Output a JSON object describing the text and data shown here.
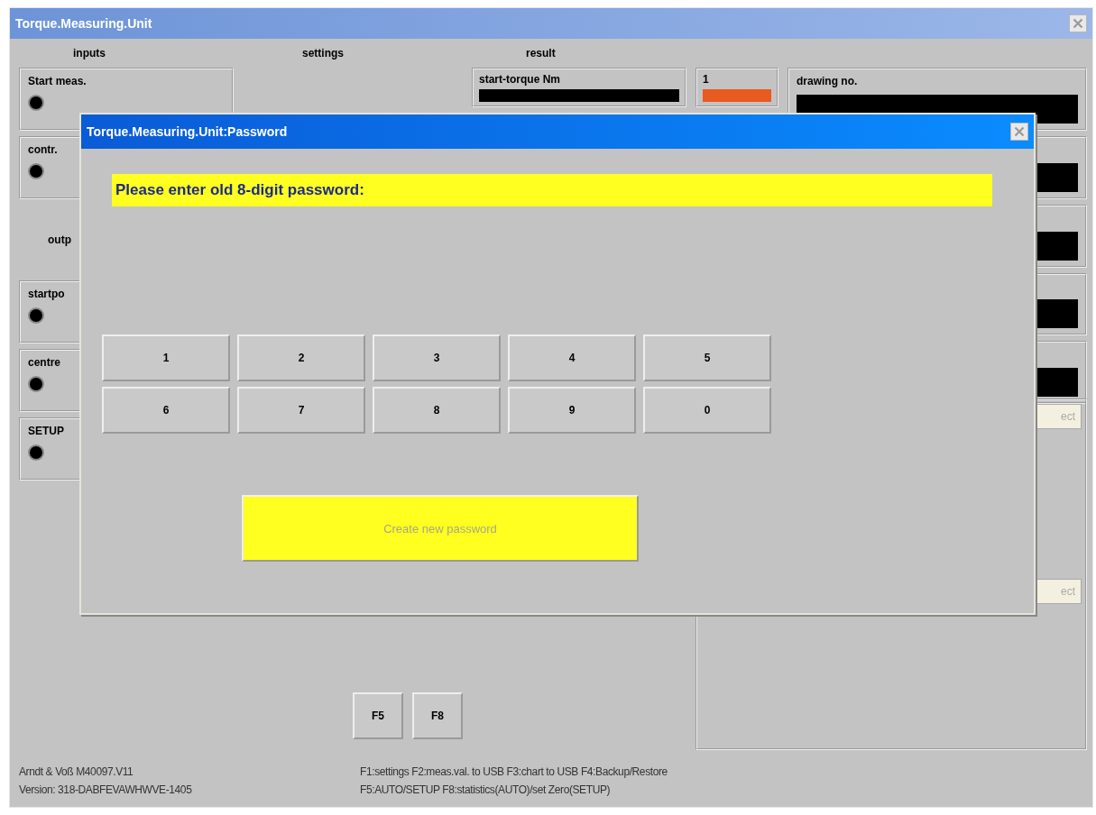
{
  "window": {
    "title": "Torque.Measuring.Unit"
  },
  "headers": {
    "inputs": "inputs",
    "settings": "settings",
    "result": "result"
  },
  "inputs": [
    {
      "label": "Start meas.",
      "on": false
    },
    {
      "label": "contr.",
      "on": false
    }
  ],
  "outputs_label": "outp",
  "outputs": [
    {
      "label": "startpo",
      "on": false
    },
    {
      "label": "centre",
      "on": false
    },
    {
      "label": "SETUP",
      "on": false
    }
  ],
  "result": {
    "start_torque_label": "start-torque Nm",
    "counter": "1",
    "drawing_no_label": "drawing no."
  },
  "right_buttons": [
    "ect",
    "ect"
  ],
  "function_buttons": [
    "F5",
    "F8"
  ],
  "footer": {
    "vendor": "Arndt & Voß  M40097.V11",
    "version": "Version: 318-DABFEVAWHWVE-1405",
    "help_1": "F1:settings F2:meas.val. to USB F3:chart to USB F4:Backup/Restore",
    "help_2": "F5:AUTO/SETUP F8:statistics(AUTO)/set Zero(SETUP)"
  },
  "dialog": {
    "title": "Torque.Measuring.Unit:Password",
    "prompt": "Please enter old 8-digit password:",
    "keys": [
      "1",
      "2",
      "3",
      "4",
      "5",
      "6",
      "7",
      "8",
      "9",
      "0"
    ],
    "create_button": {
      "label": "Create new password",
      "disabled": true
    }
  }
}
